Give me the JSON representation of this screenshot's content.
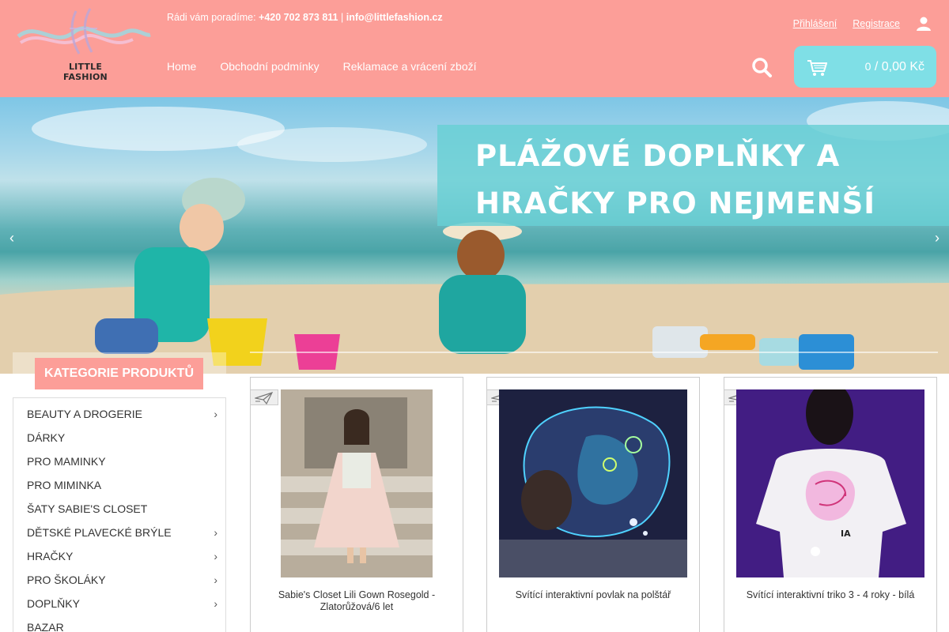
{
  "header": {
    "logo_text": "LITTLE FASHION",
    "contact_prefix": "Rádi vám poradíme:",
    "phone": "+420 702 873 811",
    "separator": "|",
    "email": "info@littlefashion.cz",
    "login": "Přihlášení",
    "register": "Registrace",
    "nav": [
      "Home",
      "Obchodní podmínky",
      "Reklamace a vrácení zboží"
    ],
    "cart_count": "0",
    "cart_separator": "/",
    "cart_total": "0,00 Kč",
    "colors": {
      "header_bg": "#fc9e98",
      "cart_bg": "#7fdfe6"
    }
  },
  "banner": {
    "line1": "PLÁŽOVÉ DOPLŇKY A",
    "line2": "HRAČKY PRO NEJMENŠÍ"
  },
  "sidebar": {
    "title": "KATEGORIE PRODUKTŮ",
    "items": [
      {
        "label": "BEAUTY A DROGERIE",
        "chevron": true
      },
      {
        "label": "DÁRKY",
        "chevron": false
      },
      {
        "label": "PRO MAMINKY",
        "chevron": false
      },
      {
        "label": "PRO MIMINKA",
        "chevron": false
      },
      {
        "label": "ŠATY SABIE'S CLOSET",
        "chevron": false
      },
      {
        "label": "DĚTSKÉ PLAVECKÉ BRÝLE",
        "chevron": true
      },
      {
        "label": "HRAČKY",
        "chevron": true
      },
      {
        "label": "PRO ŠKOLÁKY",
        "chevron": true
      },
      {
        "label": "DOPLŇKY",
        "chevron": true
      },
      {
        "label": "BAZAR",
        "chevron": false
      }
    ]
  },
  "products": [
    {
      "name": "Sabie's Closet Lili Gown Rosegold - Zlatorůžová/6 let"
    },
    {
      "name": "Svítící interaktivní povlak na polštář"
    },
    {
      "name": "Svítící interaktivní triko 3 - 4 roky - bílá"
    }
  ]
}
